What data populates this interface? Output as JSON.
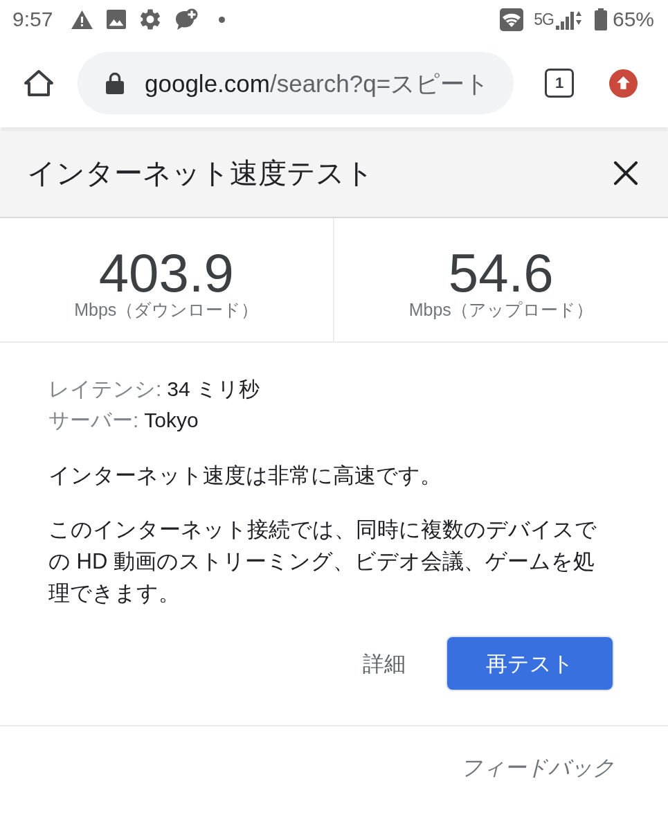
{
  "status_bar": {
    "time": "9:57",
    "network": "5G",
    "battery": "65%"
  },
  "browser": {
    "url_host": "google.com",
    "url_path": "/search?q=スピート",
    "tab_count": "1"
  },
  "card": {
    "title": "インターネット速度テスト",
    "results": [
      {
        "value": "403.9",
        "unit": "Mbps（ダウンロード）"
      },
      {
        "value": "54.6",
        "unit": "Mbps（アップロード）"
      }
    ],
    "details": [
      {
        "label": "レイテンシ:",
        "value": "34 ミリ秒"
      },
      {
        "label": "サーバー:",
        "value": "Tokyo"
      }
    ],
    "verdict": "インターネット速度は非常に高速です。",
    "description": "このインターネット接続では、同時に複数のデバイスでの HD 動画のストリーミング、ビデオ会議、ゲームを処理できます。",
    "buttons": [
      {
        "label": "詳細",
        "kind": "text"
      },
      {
        "label": "再テスト",
        "kind": "primary"
      }
    ],
    "feedback": "フィードバック"
  }
}
